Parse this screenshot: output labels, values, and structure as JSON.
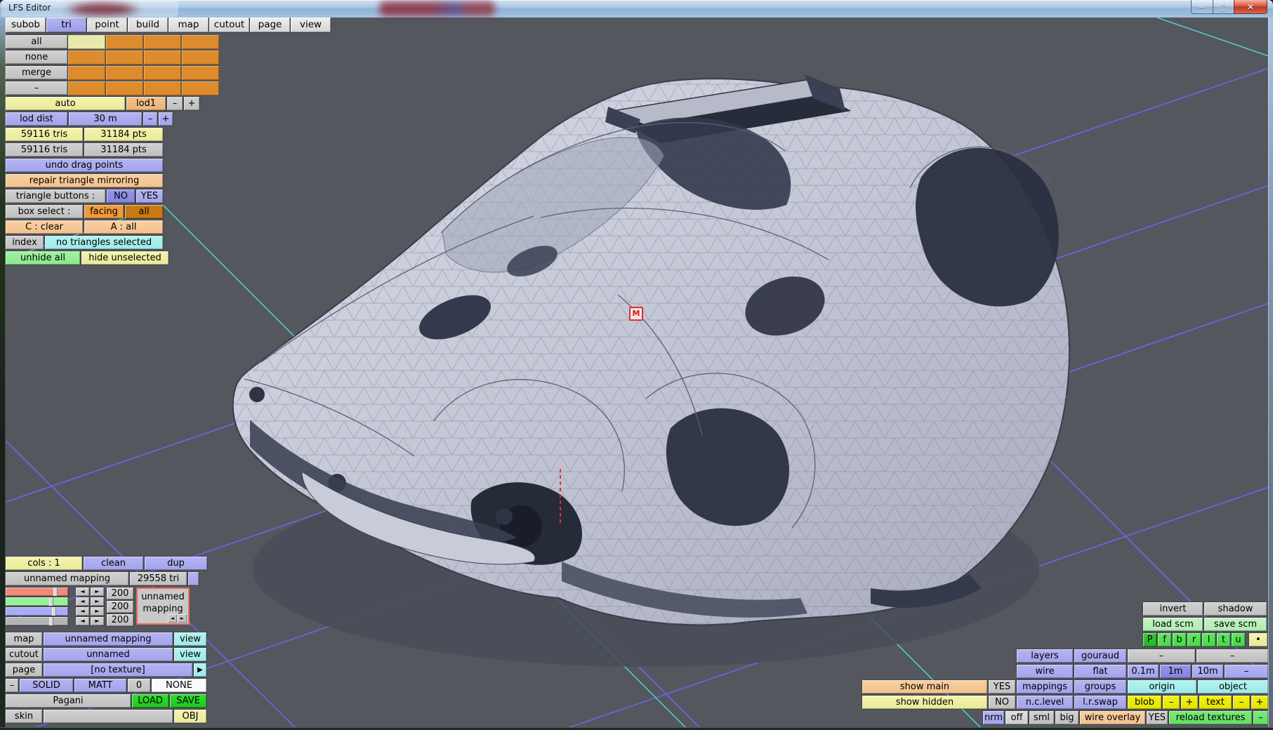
{
  "window": {
    "title": "LFS Editor",
    "controls": {
      "minimize": "—",
      "maximize": "▢",
      "close": "✕"
    }
  },
  "menu": {
    "tabs": [
      "subob",
      "tri",
      "point",
      "build",
      "map",
      "cutout",
      "page",
      "view"
    ],
    "selected": "tri"
  },
  "left_panel": {
    "sel": {
      "all": "all",
      "none": "none",
      "merge": "merge",
      "dash": "–"
    },
    "lod": {
      "auto": "auto",
      "lod1": "lod1",
      "minus": "–",
      "plus": "+"
    },
    "lod_dist": {
      "label": "lod dist",
      "value": "30 m",
      "minus": "–",
      "plus": "+"
    },
    "stats_active": {
      "tris": "59116 tris",
      "pts": "31184 pts"
    },
    "stats_total": {
      "tris": "59116 tris",
      "pts": "31184 pts"
    },
    "undo": "undo drag points",
    "repair": "repair triangle mirroring",
    "triangle_buttons": {
      "label": "triangle buttons :",
      "no": "NO",
      "yes": "YES"
    },
    "box_select": {
      "label": "box select :",
      "facing": "facing",
      "all": "all"
    },
    "shortcuts": {
      "clear": "C : clear",
      "all": "A : all"
    },
    "selection": {
      "index": "index",
      "status": "no triangles selected"
    },
    "visibility": {
      "unhide": "unhide all",
      "hide": "hide unselected"
    }
  },
  "mapping_panel": {
    "header": {
      "cols": "cols : 1",
      "clean": "clean",
      "dup": "dup"
    },
    "mapping": {
      "name": "unnamed mapping",
      "count": "29558 tri"
    },
    "rgb": {
      "r": "200",
      "g": "200",
      "b": "200",
      "left": "◄",
      "right": "►"
    },
    "mapping_box": {
      "name": "unnamed mapping",
      "left": "◄",
      "right": "►"
    },
    "rows": {
      "map": "map",
      "map_value": "unnamed mapping",
      "map_action": "view",
      "cutout": "cutout",
      "cutout_value": "unnamed",
      "cutout_action": "view",
      "page": "page",
      "page_value": "[no texture]",
      "page_action": "▶"
    },
    "material": {
      "minus": "–",
      "solid": "SOLID",
      "matt": "MATT",
      "zero": "0",
      "none": "NONE"
    },
    "file": {
      "name": "Pagani",
      "load": "LOAD",
      "save": "SAVE"
    },
    "skin": {
      "label": "skin",
      "obj": "OBJ"
    }
  },
  "right_panel": {
    "scm": {
      "invert": "invert",
      "shadow": "shadow",
      "load": "load scm",
      "save": "save scm"
    },
    "axes": [
      "P",
      "f",
      "b",
      "r",
      "l",
      "t",
      "u"
    ],
    "axes_dot": "•",
    "view_rows": {
      "layers": "layers",
      "gouraud": "gouraud",
      "dash1": "–",
      "dash2": "–",
      "wire": "wire",
      "flat": "flat",
      "m01": "0.1m",
      "m1": "1m",
      "m10": "10m",
      "dash3": "–"
    },
    "display": {
      "show_main": "show main",
      "show_main_val": "YES",
      "mappings": "mappings",
      "groups": "groups",
      "origin": "origin",
      "object": "object",
      "show_hidden": "show hidden",
      "show_hidden_val": "NO",
      "nc_level": "n.c.level",
      "lr_swap": "l.r.swap",
      "blob": "blob",
      "blob_minus": "–",
      "blob_plus": "+",
      "text": "text",
      "text_minus": "–",
      "text_plus": "+",
      "nrm": "nrm",
      "off": "off",
      "sml": "sml",
      "big": "big",
      "wire_overlay": "wire overlay",
      "wire_overlay_val": "YES",
      "reload": "reload textures",
      "reload_minus": "–"
    }
  },
  "viewport": {
    "marker_label": "M"
  },
  "colors": {
    "viewport_bg": "#54575e",
    "grid_blue": "#7265f5",
    "grid_cyan": "#55d6ce",
    "accent_purple": "#adadf2",
    "accent_orange": "#dd8b2c",
    "marker_red": "#e03030",
    "car_body": "#c5c8d6"
  }
}
